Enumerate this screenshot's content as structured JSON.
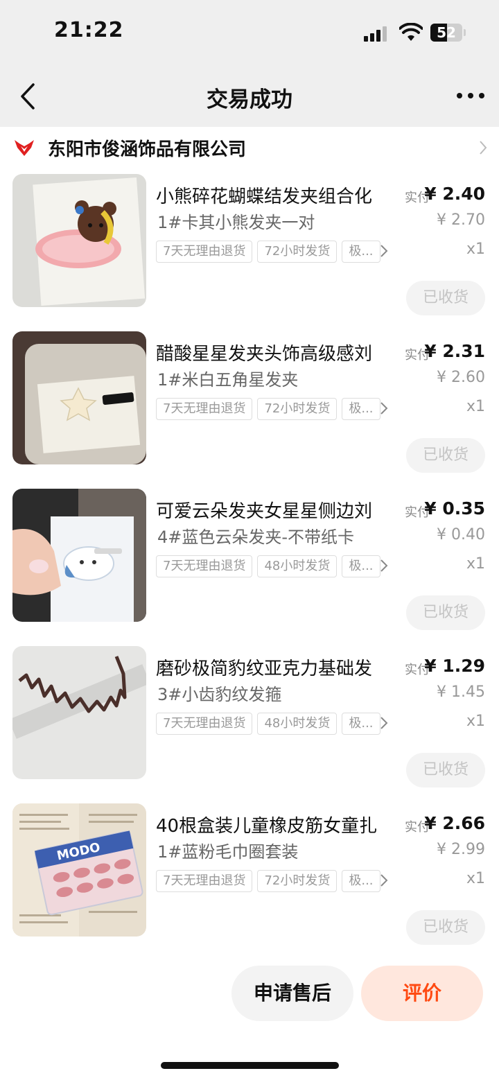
{
  "status_bar": {
    "time": "21:22",
    "battery": "52",
    "battery_level": 0.52
  },
  "header": {
    "title": "交易成功",
    "back_icon": "chevron-left-icon",
    "more_icon": "more-dots-icon"
  },
  "shop": {
    "name": "东阳市俊涵饰品有限公司",
    "logo_color": "#e02020"
  },
  "items": [
    {
      "name": "小熊碎花蝴蝶结发夹组合化",
      "sku": "1#卡其小熊发夹一对",
      "tags": [
        "7天无理由退货",
        "72小时发货",
        "极..."
      ],
      "paid_label": "实付",
      "paid": "¥ 2.40",
      "original": "¥ 2.70",
      "qty": "x1",
      "status": "已收货"
    },
    {
      "name": "醋酸星星发夹头饰高级感刘",
      "sku": "1#米白五角星发夹",
      "tags": [
        "7天无理由退货",
        "72小时发货",
        "极..."
      ],
      "paid_label": "实付",
      "paid": "¥ 2.31",
      "original": "¥ 2.60",
      "qty": "x1",
      "status": "已收货"
    },
    {
      "name": "可爱云朵发夹女星星侧边刘",
      "sku": "4#蓝色云朵发夹-不带纸卡",
      "tags": [
        "7天无理由退货",
        "48小时发货",
        "极..."
      ],
      "paid_label": "实付",
      "paid": "¥ 0.35",
      "original": "¥ 0.40",
      "qty": "x1",
      "status": "已收货"
    },
    {
      "name": "磨砂极简豹纹亚克力基础发",
      "sku": "3#小齿豹纹发箍",
      "tags": [
        "7天无理由退货",
        "48小时发货",
        "极..."
      ],
      "paid_label": "实付",
      "paid": "¥ 1.29",
      "original": "¥ 1.45",
      "qty": "x1",
      "status": "已收货"
    },
    {
      "name": "40根盒装儿童橡皮筋女童扎",
      "sku": "1#蓝粉毛巾圈套装",
      "tags": [
        "7天无理由退货",
        "72小时发货",
        "极..."
      ],
      "paid_label": "实付",
      "paid": "¥ 2.66",
      "original": "¥ 2.99",
      "qty": "x1",
      "status": "已收货"
    }
  ],
  "actions": {
    "after_sale": "申请售后",
    "review": "评价"
  },
  "colors": {
    "accent": "#ff4a12",
    "accent_bg": "#ffe7dd",
    "page_bg": "#efefef"
  }
}
